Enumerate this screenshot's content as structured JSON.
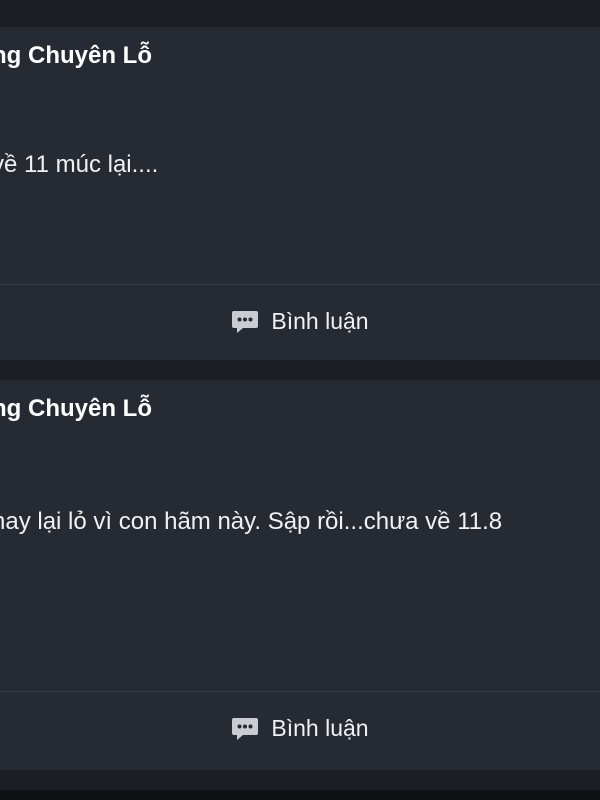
{
  "posts": [
    {
      "author": "ng Chuyên Lỗ",
      "body": "về 11 múc lại....",
      "comment_label": "Bình luận",
      "comment_icon": "comment-icon"
    },
    {
      "author": "ng Chuyên Lỗ",
      "body": "hay lại lỏ vì con hãm này. Sập rồi...chưa về 11.8",
      "comment_label": "Bình luận",
      "comment_icon": "comment-icon"
    }
  ],
  "colors": {
    "background": "#1b1f25",
    "card": "#262a33",
    "text": "#f1f1f1",
    "icon": "#c9ccd2",
    "divider": "#3a3e47"
  }
}
